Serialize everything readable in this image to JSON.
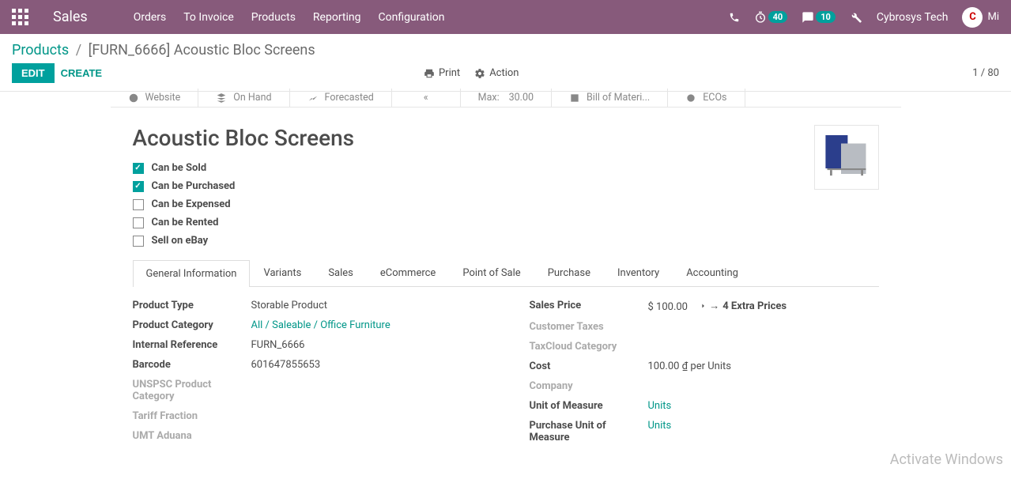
{
  "navbar": {
    "brand": "Sales",
    "menu": [
      "Orders",
      "To Invoice",
      "Products",
      "Reporting",
      "Configuration"
    ],
    "timer_badge": "40",
    "discuss_badge": "10",
    "user": "Cybrosys Tech",
    "avatar_letter": "C"
  },
  "breadcrumb": {
    "root": "Products",
    "current": "[FURN_6666] Acoustic Bloc Screens"
  },
  "buttons": {
    "edit": "EDIT",
    "create": "CREATE",
    "print": "Print",
    "action": "Action"
  },
  "pager": "1 / 80",
  "ribbon": {
    "website": "Website",
    "onhand": "On Hand",
    "forecasted": "Forecasted",
    "max_label": "Max:",
    "max_value": "30.00",
    "bom": "Bill of Materi...",
    "ecos": "ECOs"
  },
  "product": {
    "name": "Acoustic Bloc Screens",
    "checks": [
      {
        "label": "Can be Sold",
        "checked": true
      },
      {
        "label": "Can be Purchased",
        "checked": true
      },
      {
        "label": "Can be Expensed",
        "checked": false
      },
      {
        "label": "Can be Rented",
        "checked": false
      },
      {
        "label": "Sell on eBay",
        "checked": false
      }
    ]
  },
  "tabs": [
    "General Information",
    "Variants",
    "Sales",
    "eCommerce",
    "Point of Sale",
    "Purchase",
    "Inventory",
    "Accounting"
  ],
  "left_fields": [
    {
      "label": "Product Type",
      "value": "Storable Product"
    },
    {
      "label": "Product Category",
      "value": "All / Saleable / Office Furniture",
      "link": true
    },
    {
      "label": "Internal Reference",
      "value": "FURN_6666"
    },
    {
      "label": "Barcode",
      "value": "601647855653"
    },
    {
      "label": "UNSPSC Product Category",
      "value": "",
      "muted": true
    },
    {
      "label": "Tariff Fraction",
      "value": "",
      "muted": true
    },
    {
      "label": "UMT Aduana",
      "value": "",
      "muted": true
    }
  ],
  "right_fields": {
    "sales_price_label": "Sales Price",
    "sales_price_value": "$ 100.00",
    "extra_prices": "4 Extra Prices",
    "customer_taxes": "Customer Taxes",
    "taxcloud": "TaxCloud Category",
    "cost_label": "Cost",
    "cost_value": "100.00 ₫  per Units",
    "company": "Company",
    "uom_label": "Unit of Measure",
    "uom_value": "Units",
    "puom_label": "Purchase Unit of Measure",
    "puom_value": "Units"
  },
  "watermark": "Activate Windows"
}
